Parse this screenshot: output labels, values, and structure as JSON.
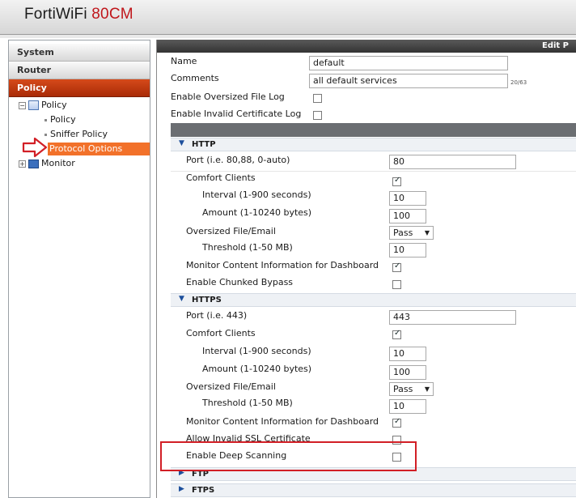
{
  "brand": {
    "name": "FortiWiFi",
    "model": "80CM"
  },
  "nav": {
    "buttons": [
      {
        "label": "System",
        "active": false
      },
      {
        "label": "Router",
        "active": false
      },
      {
        "label": "Policy",
        "active": true
      }
    ],
    "tree": {
      "policy_root": "Policy",
      "policy": "Policy",
      "sniffer": "Sniffer Policy",
      "protocol_options": "Protocol Options",
      "monitor": "Monitor"
    }
  },
  "main": {
    "header": "Edit P",
    "name_label": "Name",
    "name_value": "default",
    "comments_label": "Comments",
    "comments_value": "all default services",
    "comments_count": "20/63",
    "oversized_log_label": "Enable Oversized File Log",
    "invalid_cert_label": "Enable Invalid Certificate Log",
    "http": {
      "title": "HTTP",
      "port_label": "Port (i.e. 80,88, 0-auto)",
      "port_value": "80",
      "comfort_label": "Comfort Clients",
      "interval_label": "Interval (1-900 seconds)",
      "interval_value": "10",
      "amount_label": "Amount (1-10240 bytes)",
      "amount_value": "100",
      "oversized_label": "Oversized File/Email",
      "oversized_value": "Pass",
      "threshold_label": "Threshold (1-50 MB)",
      "threshold_value": "10",
      "monitor_label": "Monitor Content Information for Dashboard",
      "chunked_label": "Enable Chunked Bypass"
    },
    "https": {
      "title": "HTTPS",
      "port_label": "Port (i.e. 443)",
      "port_value": "443",
      "comfort_label": "Comfort Clients",
      "interval_label": "Interval (1-900 seconds)",
      "interval_value": "10",
      "amount_label": "Amount (1-10240 bytes)",
      "amount_value": "100",
      "oversized_label": "Oversized File/Email",
      "oversized_value": "Pass",
      "threshold_label": "Threshold (1-50 MB)",
      "threshold_value": "10",
      "monitor_label": "Monitor Content Information for Dashboard",
      "invalid_ssl_label": "Allow Invalid SSL Certificate",
      "deep_scan_label": "Enable Deep Scanning"
    },
    "ftp_title": "FTP",
    "ftps_title": "FTPS"
  },
  "colors": {
    "accent": "#c0161b",
    "nav_active": "#b8330b",
    "highlight": "#f2712a",
    "callout": "#d21f26"
  }
}
